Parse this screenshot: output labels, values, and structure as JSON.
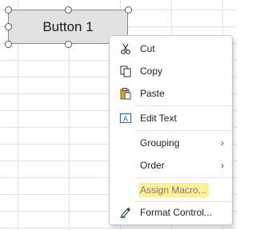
{
  "button": {
    "label": "Button 1"
  },
  "menu": {
    "items": [
      {
        "label": "Cut",
        "icon": "scissors-icon"
      },
      {
        "label": "Copy",
        "icon": "copy-icon"
      },
      {
        "label": "Paste",
        "icon": "paste-icon"
      },
      {
        "label": "Edit Text",
        "icon": "edit-text-icon"
      },
      {
        "label": "Grouping",
        "icon": "",
        "submenu": true
      },
      {
        "label": "Order",
        "icon": "",
        "submenu": true
      },
      {
        "label": "Assign Macro...",
        "icon": "",
        "highlighted": true
      },
      {
        "label": "Format Control...",
        "icon": "format-control-icon"
      }
    ]
  },
  "colors": {
    "highlight": "#fbf199",
    "button_face": "#e2e2e2",
    "grid_line": "#e1e1e1"
  }
}
